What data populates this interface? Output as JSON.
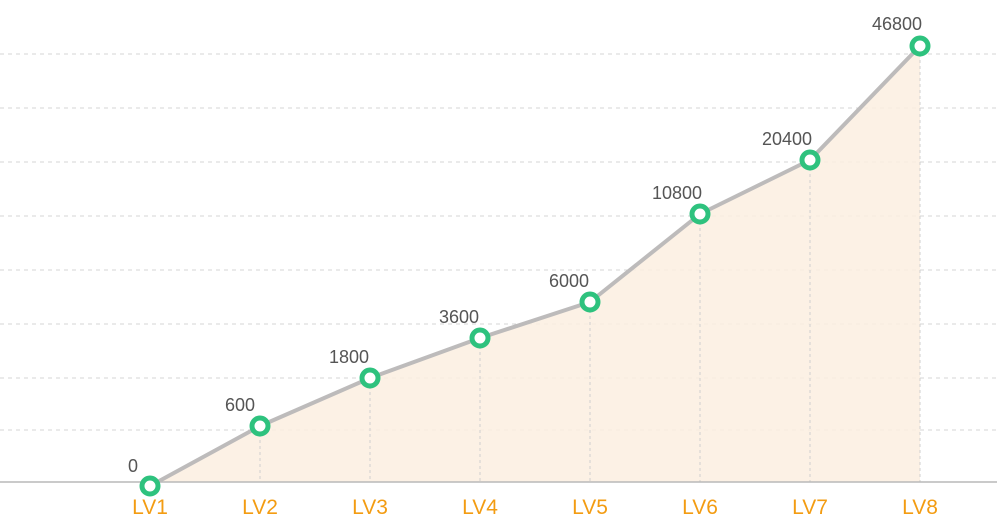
{
  "chart_data": {
    "type": "line",
    "categories": [
      "LV1",
      "LV2",
      "LV3",
      "LV4",
      "LV5",
      "LV6",
      "LV7",
      "LV8"
    ],
    "series": [
      {
        "values": [
          0,
          600,
          1800,
          3600,
          6000,
          10800,
          20400,
          46800
        ],
        "labels": [
          "0",
          "600",
          "1800",
          "3600",
          "6000",
          "10800",
          "20400",
          "46800"
        ]
      }
    ],
    "scale": "non-linear",
    "grid": true,
    "legend": "none",
    "colors": {
      "line": "#bdbbbb",
      "point": "#2ec27e",
      "area": "#fbefe1",
      "tick_label": "#f39c12",
      "data_label": "#555555"
    }
  }
}
